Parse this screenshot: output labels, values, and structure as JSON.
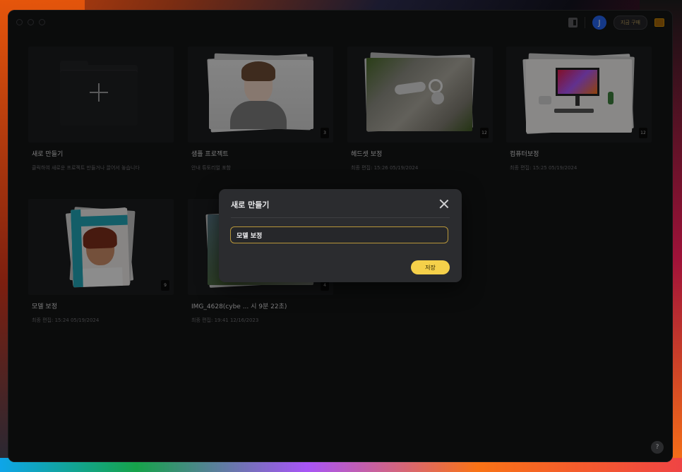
{
  "window": {
    "controls": [
      "close",
      "minimize",
      "zoom"
    ]
  },
  "topbar": {
    "panel_icon": "sidebar-icon",
    "avatar_initial": "J",
    "buy_label": "지금 구매",
    "gift_icon": "gift-icon"
  },
  "projects": [
    {
      "title": "새로 만들기",
      "subtitle": "클릭하여 새로운 프로젝트 만들거나 끌어서 놓습니다",
      "count": ""
    },
    {
      "title": "샘플 프로젝트",
      "subtitle": "안내 튜토리얼 포함",
      "count": "3"
    },
    {
      "title": "헤드셋 보정",
      "subtitle": "최종 편집: 15:26 05/19/2024",
      "count": "12"
    },
    {
      "title": "컴퓨터보정",
      "subtitle": "최종 편집: 15:25 05/19/2024",
      "count": "12"
    },
    {
      "title": "모델 보정",
      "subtitle": "최종 편집: 15:24 05/19/2024",
      "count": "9"
    },
    {
      "title": "IMG_4628(cybe ... 시 9분 22초)",
      "subtitle": "최종 편집: 19:41 12/16/2023",
      "count": "4"
    }
  ],
  "modal": {
    "title": "새로 만들기",
    "input_value": "모델 보정",
    "save_label": "저장"
  },
  "help_label": "?",
  "colors": {
    "accent": "#f5d04a",
    "input_border": "#b8973a",
    "avatar": "#2563eb"
  }
}
